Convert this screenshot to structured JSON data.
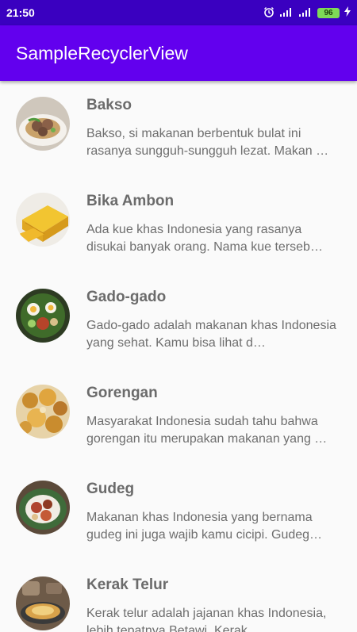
{
  "status_bar": {
    "time": "21:50",
    "battery": "96"
  },
  "app_bar": {
    "title": "SampleRecyclerView"
  },
  "items": [
    {
      "title": "Bakso",
      "description": "Bakso, si makanan berbentuk bulat ini rasanya sungguh-sungguh lezat. Makan …"
    },
    {
      "title": "Bika Ambon",
      "description": "Ada kue khas Indonesia yang rasanya disukai banyak orang. Nama kue terseb…"
    },
    {
      "title": "Gado-gado",
      "description": "Gado-gado adalah makanan khas Indonesia yang sehat. Kamu bisa lihat d…"
    },
    {
      "title": "Gorengan",
      "description": "Masyarakat Indonesia sudah tahu bahwa gorengan itu merupakan makanan yang …"
    },
    {
      "title": "Gudeg",
      "description": "Makanan khas Indonesia yang bernama gudeg ini juga wajib kamu cicipi. Gudeg…"
    },
    {
      "title": "Kerak Telur",
      "description": "Kerak telur adalah jajanan khas Indonesia, lebih tepatnya Betawi. Kerak…"
    }
  ]
}
